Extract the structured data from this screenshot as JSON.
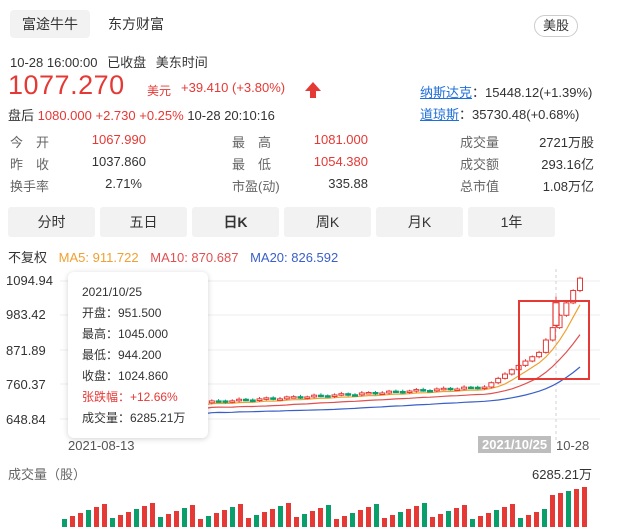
{
  "header": {
    "tabs": [
      {
        "label": "富途牛牛",
        "active": true
      },
      {
        "label": "东方财富",
        "active": false
      }
    ],
    "market_badge": "美股"
  },
  "status": {
    "datetime": "10-28 16:00:00",
    "state": "已收盘",
    "tz": "美东时间"
  },
  "price": {
    "last": "1077.270",
    "unit": "美元",
    "change": "+39.410",
    "change_pct": "(+3.80%)"
  },
  "indices": [
    {
      "name": "纳斯达克",
      "value": "15448.12(+1.39%)"
    },
    {
      "name": "道琼斯",
      "value": "35730.48(+0.68%)"
    }
  ],
  "after_hours": {
    "label": "盘后",
    "price": "1080.000",
    "change": "+2.730",
    "pct": "+0.25%",
    "time": "10-28 20:10:16"
  },
  "quote": {
    "open_label": "今　开",
    "open": "1067.990",
    "high_label": "最　高",
    "high": "1081.000",
    "volume_label": "成交量",
    "volume": "2721万股",
    "prev_label": "昨　收",
    "prev": "1037.860",
    "low_label": "最　低",
    "low": "1054.380",
    "amount_label": "成交额",
    "amount": "293.16亿",
    "turnover_label": "换手率",
    "turnover": "2.71%",
    "pe_label": "市盈(动)",
    "pe": "335.88",
    "mktcap_label": "总市值",
    "mktcap": "1.08万亿"
  },
  "periods": [
    {
      "label": "分时",
      "active": false
    },
    {
      "label": "五日",
      "active": false
    },
    {
      "label": "日K",
      "active": true
    },
    {
      "label": "周K",
      "active": false
    },
    {
      "label": "月K",
      "active": false
    },
    {
      "label": "1年",
      "active": false
    }
  ],
  "ma": {
    "adjust": "不复权",
    "ma5": "MA5: 911.722",
    "ma10": "MA10: 870.687",
    "ma20": "MA20: 826.592"
  },
  "colors": {
    "up": "#e53935",
    "down": "#0a9e6b",
    "ma5": "#f0a030",
    "ma10": "#e05050",
    "ma20": "#3a5fc8",
    "link": "#1e6fd9"
  },
  "chart_data": {
    "type": "candlestick",
    "yticks": [
      "1094.94",
      "983.42",
      "871.89",
      "760.37",
      "648.84"
    ],
    "ylim": [
      648.84,
      1094.94
    ],
    "xlabels": [
      "2021-08-13",
      "2021/10/25",
      "10-28"
    ],
    "candles_recent": [
      {
        "date": "2021/10/25",
        "open": 951.5,
        "high": 1045.0,
        "low": 944.2,
        "close": 1024.86
      }
    ],
    "volume_label": "成交量（股）",
    "volume_max": "6285.21万"
  },
  "tooltip": {
    "date": "2021/10/25",
    "open": "开盘：951.500",
    "high": "最高：1045.000",
    "low": "最低：944.200",
    "close": "收盘：1024.860",
    "pct": "张跌幅：+12.66%",
    "vol": "成交量：6285.21万"
  }
}
